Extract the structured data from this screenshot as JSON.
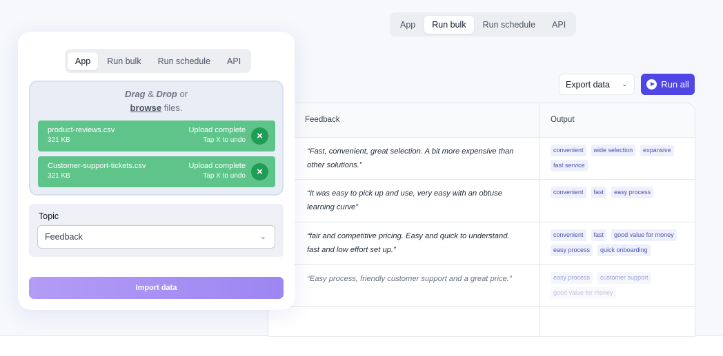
{
  "top_tabs": [
    "App",
    "Run bulk",
    "Run schedule",
    "API"
  ],
  "card_tabs": [
    "App",
    "Run bulk",
    "Run schedule",
    "API"
  ],
  "toolbar": {
    "export_label": "Export data",
    "run_all_label": "Run all"
  },
  "table": {
    "headers": [
      "Feedback",
      "Output"
    ],
    "rows": [
      {
        "feedback_line1": "“Fast, convenient, great selection. A bit more expensive than",
        "feedback_line2": "other solutions.”",
        "tags": [
          "convenient",
          "wide selection",
          "expansive",
          "fast service"
        ]
      },
      {
        "feedback_line1": "“It was easy to pick up and use, very easy with an obtuse",
        "feedback_line2": "learning curve”",
        "tags": [
          "convenient",
          "fast",
          "easy process"
        ]
      },
      {
        "feedback_line1": "“fair and competitive pricing. Easy and quick to understand.",
        "feedback_line2": "fast and low effort set up.”",
        "tags": [
          "convenient",
          "fast",
          "good value for money",
          "easy process",
          "quick onboarding"
        ]
      },
      {
        "feedback_line1": "“Easy process, friendly customer support and a great price.”",
        "feedback_line2": "",
        "tags": [
          "easy process",
          "customer support",
          "good value for money"
        ]
      }
    ]
  },
  "dropzone": {
    "drag": "Drag",
    "amp": "&",
    "drop": "Drop",
    "or": "or",
    "browse": "browse",
    "files": "files."
  },
  "files": [
    {
      "name": "product-reviews.csv",
      "size": "321 KB",
      "status": "Upload complete",
      "undo": "Tap X to undo"
    },
    {
      "name": "Customer-support-tickets.csv",
      "size": "321 KB",
      "status": "Upload complete",
      "undo": "Tap X to undo"
    }
  ],
  "topic": {
    "label": "Topic",
    "value": "Feedback"
  },
  "import_label": "Import data",
  "colors": {
    "accent": "#4f46e5",
    "success": "#5ec48a",
    "import": "#a58ef3"
  }
}
